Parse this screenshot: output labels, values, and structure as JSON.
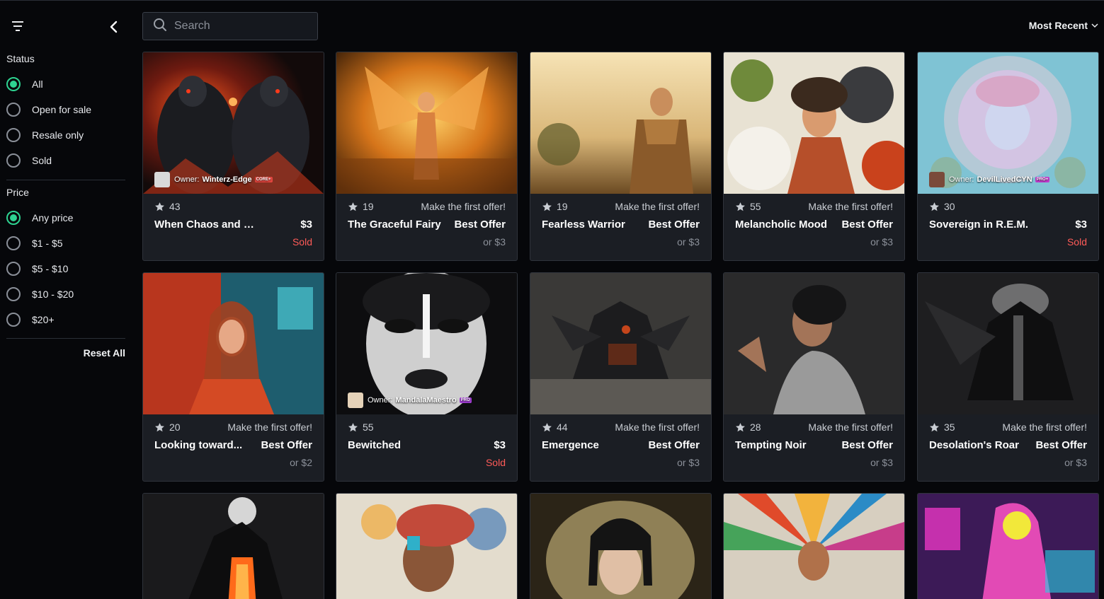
{
  "search": {
    "placeholder": "Search"
  },
  "sort": {
    "label": "Most Recent"
  },
  "filters": {
    "status_title": "Status",
    "status_options": [
      {
        "label": "All",
        "checked": true
      },
      {
        "label": "Open for sale",
        "checked": false
      },
      {
        "label": "Resale only",
        "checked": false
      },
      {
        "label": "Sold",
        "checked": false
      }
    ],
    "price_title": "Price",
    "price_options": [
      {
        "label": "Any price",
        "checked": true
      },
      {
        "label": "$1 - $5",
        "checked": false
      },
      {
        "label": "$5 - $10",
        "checked": false
      },
      {
        "label": "$10 - $20",
        "checked": false
      },
      {
        "label": "$20+",
        "checked": false
      }
    ],
    "reset_label": "Reset All"
  },
  "cards": [
    {
      "title": "When Chaos and Order...",
      "favorites": "43",
      "offer_note": "",
      "price": "$3",
      "sub": "Sold",
      "sold": true,
      "owner_label": "Owner:",
      "owner_name": "Winterz-Edge",
      "owner_tier": "CORE+",
      "tier_color": "#e2463f"
    },
    {
      "title": "The Graceful Fairy",
      "favorites": "19",
      "offer_note": "Make the first offer!",
      "price": "Best Offer",
      "sub": "or $3",
      "sold": false
    },
    {
      "title": "Fearless Warrior",
      "favorites": "19",
      "offer_note": "Make the first offer!",
      "price": "Best Offer",
      "sub": "or $3",
      "sold": false
    },
    {
      "title": "Melancholic Mood",
      "favorites": "55",
      "offer_note": "Make the first offer!",
      "price": "Best Offer",
      "sub": "or $3",
      "sold": false
    },
    {
      "title": "Sovereign in R.E.M.",
      "favorites": "30",
      "offer_note": "",
      "price": "$3",
      "sub": "Sold",
      "sold": true,
      "owner_label": "Owner:",
      "owner_name": "DevilLivedCYN",
      "owner_tier": "PRO+",
      "tier_color": "#c53ccf"
    },
    {
      "title": "Looking toward...",
      "favorites": "20",
      "offer_note": "Make the first offer!",
      "price": "Best Offer",
      "sub": "or $2",
      "sold": false
    },
    {
      "title": "Bewitched",
      "favorites": "55",
      "offer_note": "",
      "price": "$3",
      "sub": "Sold",
      "sold": true,
      "owner_label": "Owner:",
      "owner_name": "MandalaMaestro",
      "owner_tier": "PRO",
      "tier_color": "#a33ed6"
    },
    {
      "title": "Emergence",
      "favorites": "44",
      "offer_note": "Make the first offer!",
      "price": "Best Offer",
      "sub": "or $3",
      "sold": false
    },
    {
      "title": "Tempting Noir",
      "favorites": "28",
      "offer_note": "Make the first offer!",
      "price": "Best Offer",
      "sub": "or $3",
      "sold": false
    },
    {
      "title": "Desolation's Roar",
      "favorites": "35",
      "offer_note": "Make the first offer!",
      "price": "Best Offer",
      "sub": "or $3",
      "sold": false
    }
  ],
  "colors": {
    "accent": "#2ed391",
    "sold": "#ff5b58",
    "card_bg": "#1b1e24",
    "page_bg": "#06070a"
  }
}
